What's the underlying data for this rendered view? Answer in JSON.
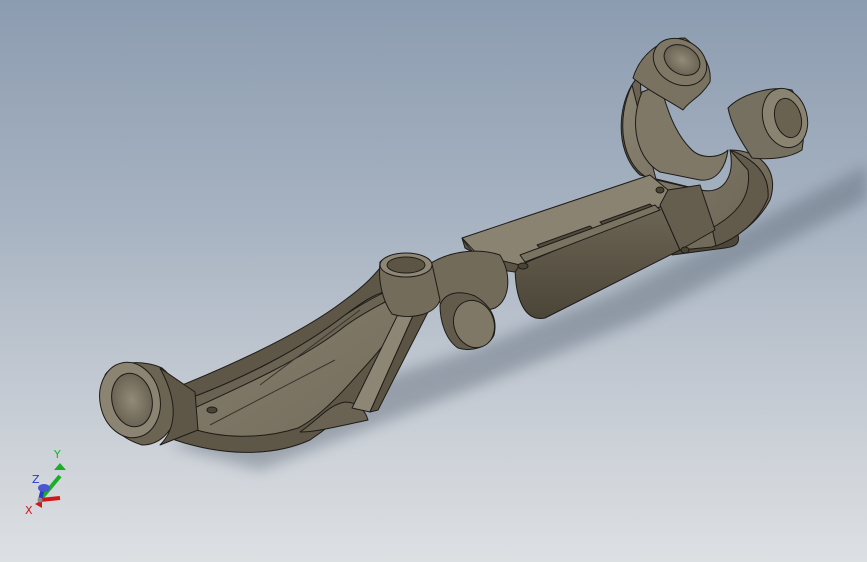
{
  "viewport": {
    "background_top": "#8c9cb0",
    "background_bottom": "#dde0e3",
    "part_color": "#6f6655",
    "edge_color": "#1e1c18"
  },
  "triad": {
    "x_label": "X",
    "y_label": "Y",
    "z_label": "Z",
    "x_color": "#d01818",
    "y_color": "#18b028",
    "z_color": "#2a3ac8"
  }
}
